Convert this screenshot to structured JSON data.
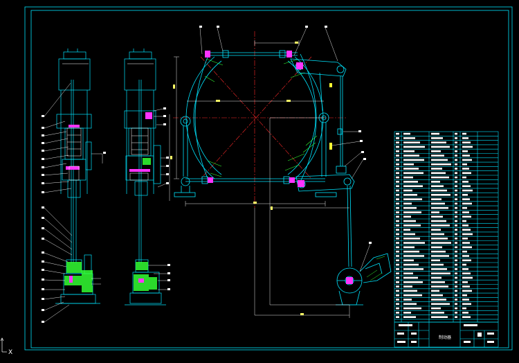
{
  "drawing": {
    "background": "#000000",
    "frame_color": "#00ffff",
    "geometry_color": "#00ffff",
    "centerline_color": "#ff2a2a",
    "dimension_color": "#ffff00",
    "hatch_color": "#33ff33",
    "body_color": "#00ffff",
    "accent_color": "#ff00ff",
    "title_block_caption": "制动器",
    "ucs_icon": "ucs-axis-icon",
    "ucs_label": "X"
  }
}
